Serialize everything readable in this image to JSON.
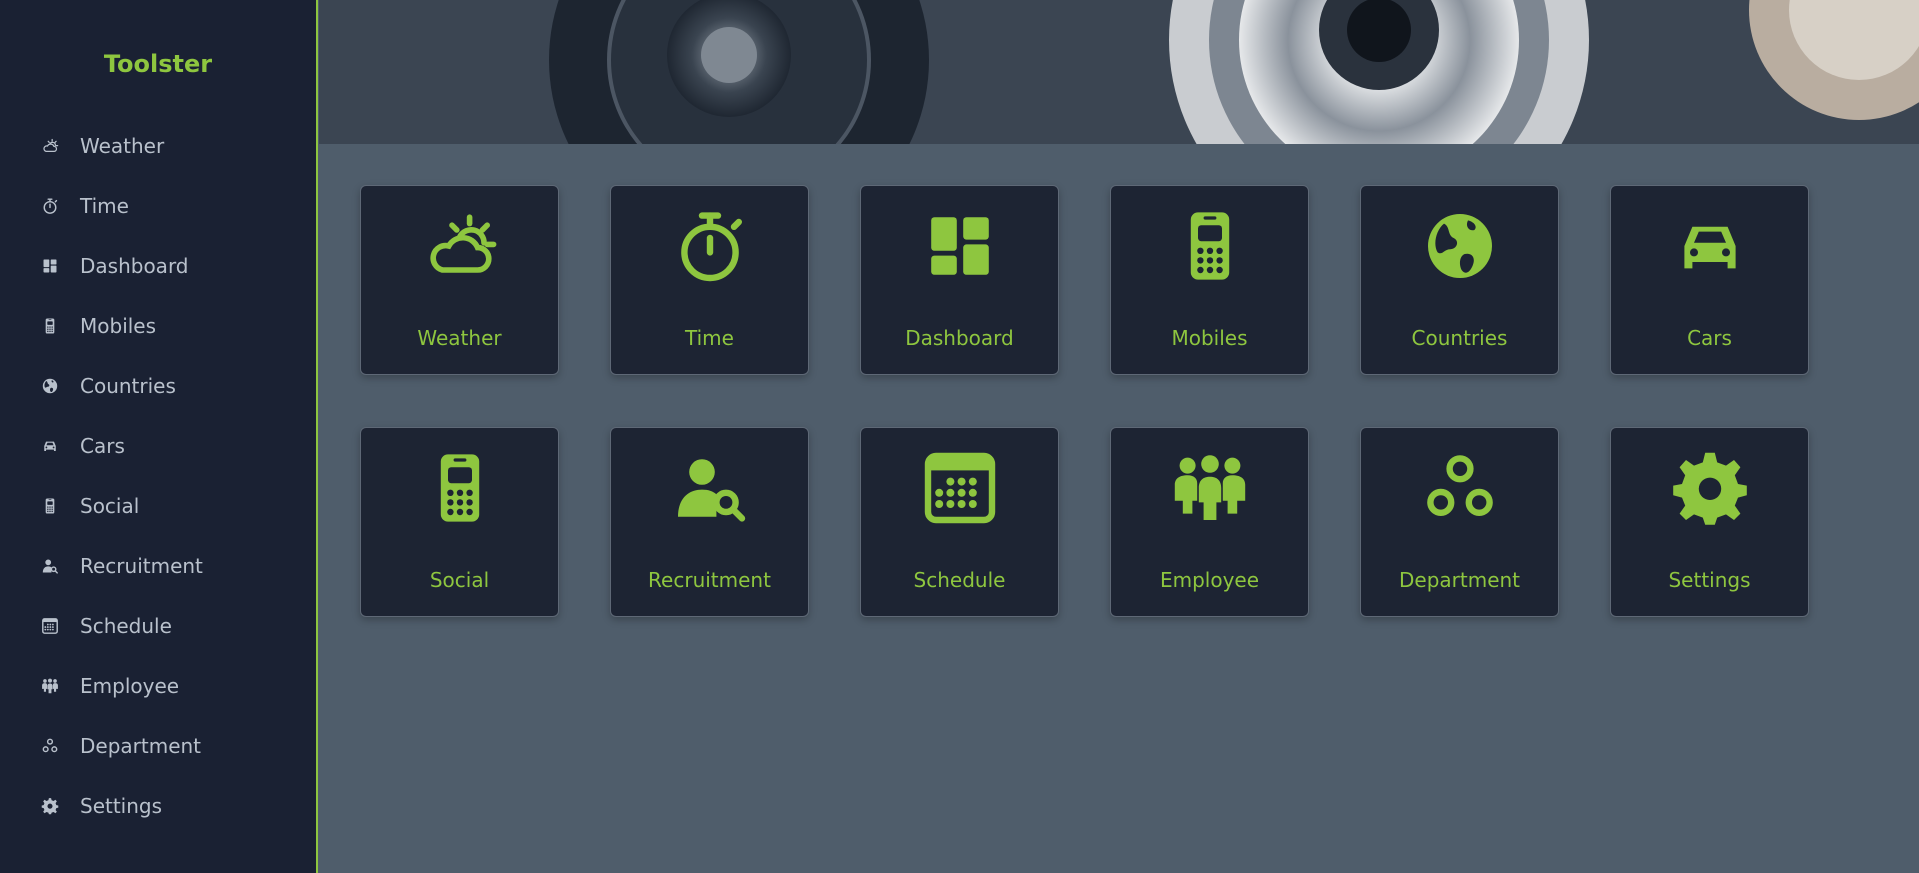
{
  "app": {
    "brand": "Toolster",
    "accent_color": "#8ec63f",
    "sidebar_bg": "#1a2133",
    "content_bg": "#4f5d6b"
  },
  "sidebar": {
    "items": [
      {
        "label": "Weather",
        "icon": "weather-icon"
      },
      {
        "label": "Time",
        "icon": "stopwatch-icon"
      },
      {
        "label": "Dashboard",
        "icon": "dashboard-icon"
      },
      {
        "label": "Mobiles",
        "icon": "mobile-icon"
      },
      {
        "label": "Countries",
        "icon": "globe-icon"
      },
      {
        "label": "Cars",
        "icon": "car-icon"
      },
      {
        "label": "Social",
        "icon": "mobile-icon"
      },
      {
        "label": "Recruitment",
        "icon": "user-search-icon"
      },
      {
        "label": "Schedule",
        "icon": "calendar-icon"
      },
      {
        "label": "Employee",
        "icon": "people-group-icon"
      },
      {
        "label": "Department",
        "icon": "circles-icon"
      },
      {
        "label": "Settings",
        "icon": "gear-icon"
      }
    ]
  },
  "banner": {
    "image": "gears-banner-image"
  },
  "tiles": [
    {
      "label": "Weather",
      "icon": "weather-icon"
    },
    {
      "label": "Time",
      "icon": "stopwatch-icon"
    },
    {
      "label": "Dashboard",
      "icon": "dashboard-icon"
    },
    {
      "label": "Mobiles",
      "icon": "mobile-icon"
    },
    {
      "label": "Countries",
      "icon": "globe-icon"
    },
    {
      "label": "Cars",
      "icon": "car-icon"
    },
    {
      "label": "Social",
      "icon": "mobile-icon"
    },
    {
      "label": "Recruitment",
      "icon": "user-search-icon"
    },
    {
      "label": "Schedule",
      "icon": "calendar-icon"
    },
    {
      "label": "Employee",
      "icon": "people-group-icon"
    },
    {
      "label": "Department",
      "icon": "circles-icon"
    },
    {
      "label": "Settings",
      "icon": "gear-icon"
    }
  ]
}
